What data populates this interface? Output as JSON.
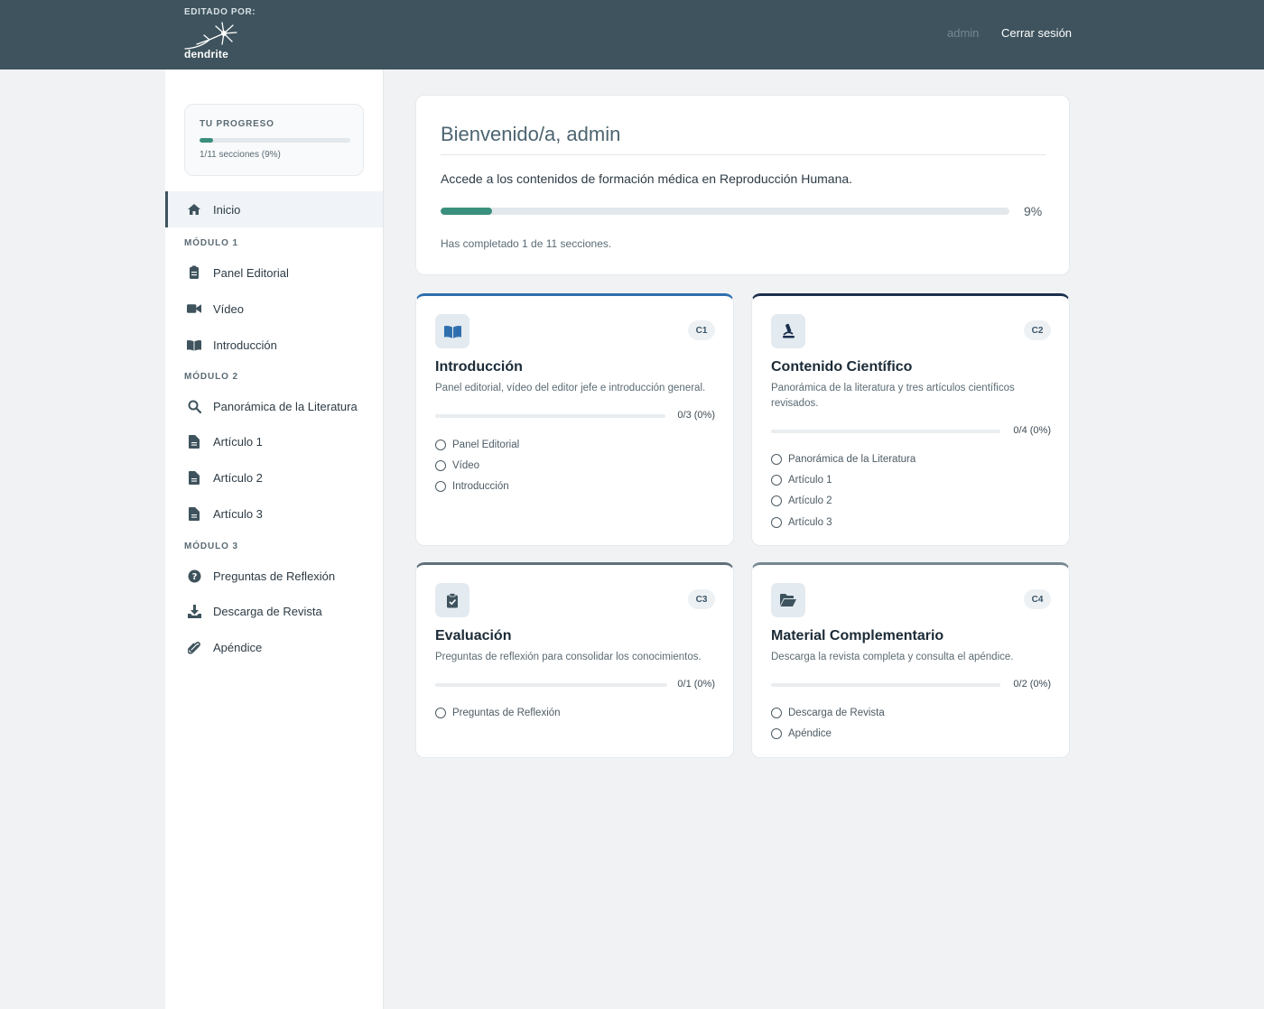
{
  "header": {
    "edited_by": "EDITADO POR:",
    "logo_text": "dendrite",
    "user": "admin",
    "logout": "Cerrar sesión"
  },
  "sidebar": {
    "progress": {
      "label": "TU PROGRESO",
      "text": "1/11 secciones (9%)",
      "fraction": 0.09
    },
    "home": {
      "label": "Inicio",
      "icon": "home-icon"
    },
    "modules": [
      {
        "label": "MÓDULO 1",
        "items": [
          {
            "label": "Panel Editorial",
            "icon": "clipboard-icon"
          },
          {
            "label": "Vídeo",
            "icon": "video-icon"
          },
          {
            "label": "Introducción",
            "icon": "book-icon"
          }
        ]
      },
      {
        "label": "MÓDULO 2",
        "items": [
          {
            "label": "Panorámica de la Literatura",
            "icon": "search-icon"
          },
          {
            "label": "Artículo 1",
            "icon": "document-icon"
          },
          {
            "label": "Artículo 2",
            "icon": "document-icon"
          },
          {
            "label": "Artículo 3",
            "icon": "document-icon"
          }
        ]
      },
      {
        "label": "MÓDULO 3",
        "items": [
          {
            "label": "Preguntas de Reflexión",
            "icon": "question-icon"
          },
          {
            "label": "Descarga de Revista",
            "icon": "download-icon"
          },
          {
            "label": "Apéndice",
            "icon": "paperclip-icon"
          }
        ]
      }
    ]
  },
  "welcome": {
    "title": "Bienvenido/a, admin",
    "description": "Accede a los contenidos de formación médica en Reproducción Humana.",
    "percent": "9%",
    "fraction": 0.09,
    "completed": "Has completado 1 de 11 secciones."
  },
  "cards": [
    {
      "badge": "C1",
      "icon": "book-icon",
      "title": "Introducción",
      "description": "Panel editorial, vídeo del editor jefe e introducción general.",
      "progress": "0/3 (0%)",
      "fraction": 0,
      "items": [
        "Panel Editorial",
        "Vídeo",
        "Introducción"
      ],
      "accent": "#2f6fae"
    },
    {
      "badge": "C2",
      "icon": "microscope-icon",
      "title": "Contenido Científico",
      "description": "Panorámica de la literatura y tres artículos científicos revisados.",
      "progress": "0/4 (0%)",
      "fraction": 0,
      "items": [
        "Panorámica de la Literatura",
        "Artículo 1",
        "Artículo 2",
        "Artículo 3"
      ],
      "accent": "#1c2f4d"
    },
    {
      "badge": "C3",
      "icon": "clipboard-check-icon",
      "title": "Evaluación",
      "description": "Preguntas de reflexión para consolidar los conocimientos.",
      "progress": "0/1 (0%)",
      "fraction": 0,
      "items": [
        "Preguntas de Reflexión"
      ],
      "accent": "#5f7078"
    },
    {
      "badge": "C4",
      "icon": "folder-open-icon",
      "title": "Material Complementario",
      "description": "Descarga la revista completa y consulta el apéndice.",
      "progress": "0/2 (0%)",
      "fraction": 0,
      "items": [
        "Descarga de Revista",
        "Apéndice"
      ],
      "accent": "#75878f"
    }
  ],
  "colors": {
    "header": "#3e535d",
    "progress": "#3a8f7d",
    "background": "#f0f2f4"
  }
}
